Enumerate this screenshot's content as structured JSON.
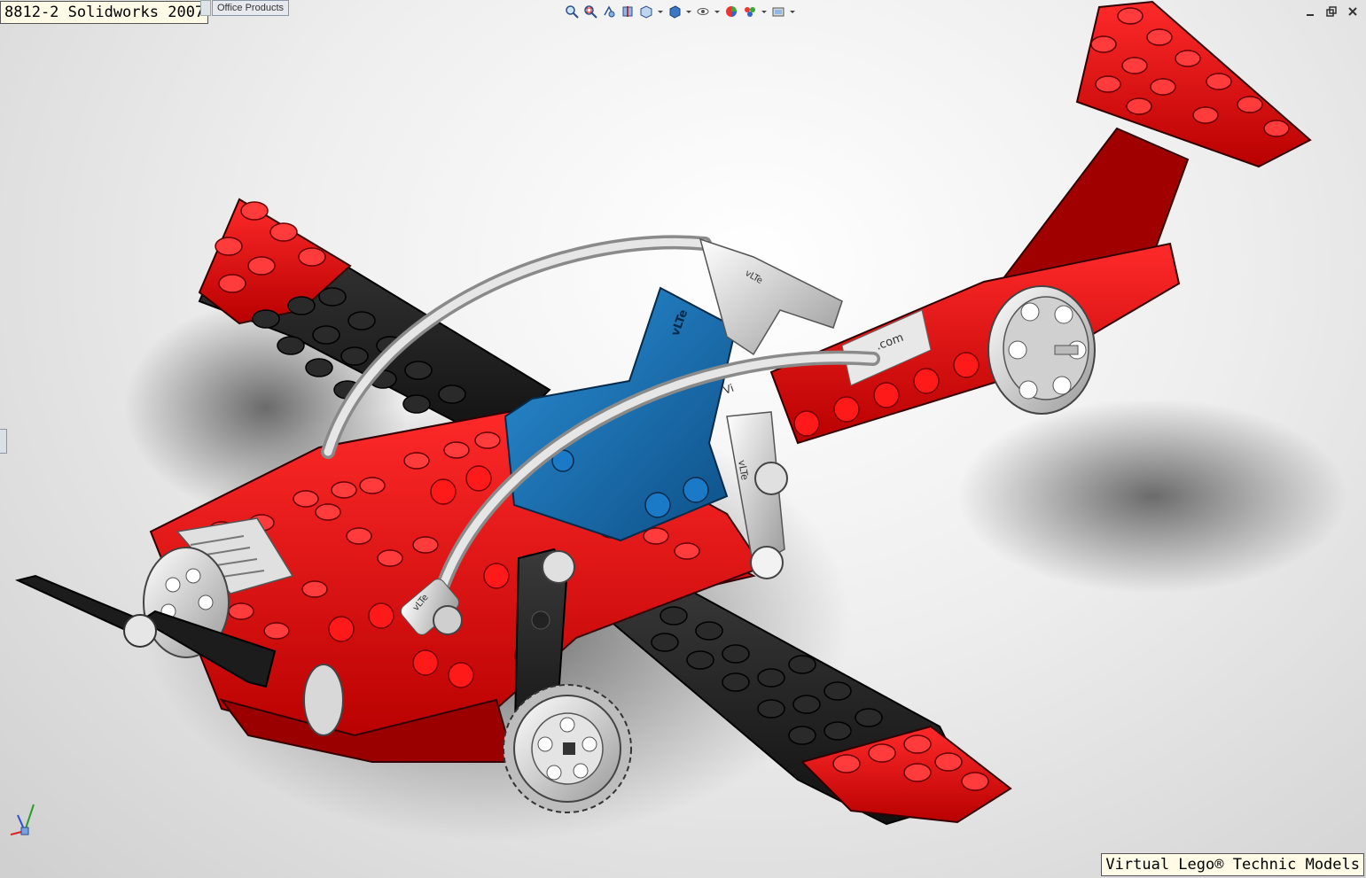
{
  "window": {
    "title": "8812-2 Solidworks 2007"
  },
  "command_manager": {
    "tab_label": "Office Products"
  },
  "footer": {
    "text": "Virtual Lego® Technic Models"
  },
  "view_toolbar": {
    "icons": [
      "zoom-to-fit-icon",
      "zoom-to-area-icon",
      "previous-view-icon",
      "section-view-icon",
      "view-orientation-icon",
      "display-style-icon",
      "hide-show-icon",
      "edit-appearance-icon",
      "apply-scene-icon",
      "view-settings-icon"
    ]
  },
  "model": {
    "part_text": [
      "vLTe",
      "vLTe",
      "vLTe",
      "vLTe",
      ".com",
      "Vi"
    ],
    "colors": {
      "red": "#e80000",
      "red_dark": "#8a0000",
      "black": "#262626",
      "blue": "#1a6fb0",
      "grey": "#d9d9d9"
    }
  }
}
